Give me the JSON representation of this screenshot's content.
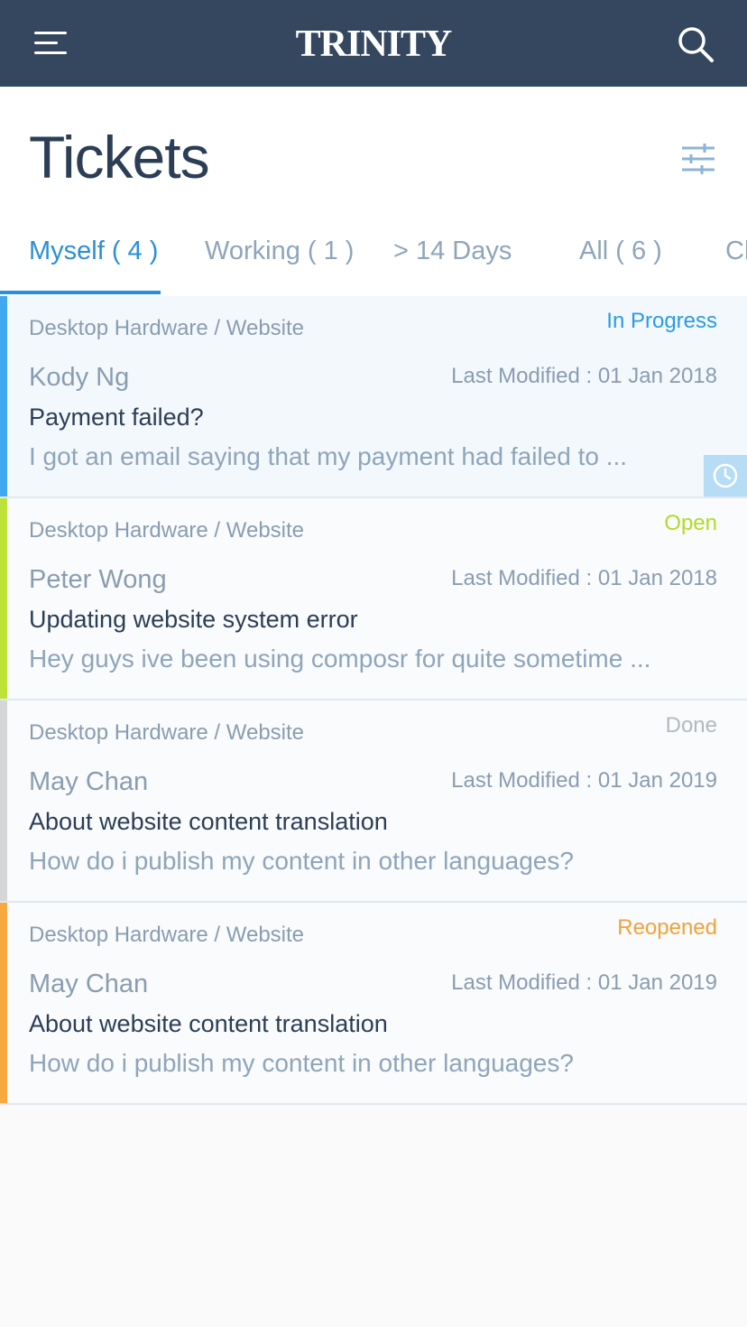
{
  "app": {
    "brand": "TRINITY",
    "icons": {
      "menu": "hamburger-menu-icon",
      "search": "search-icon"
    }
  },
  "header": {
    "title": "Tickets",
    "filter_icon": "sliders-filter-icon"
  },
  "tabs": [
    {
      "label": "Myself ( 4 )",
      "active": true
    },
    {
      "label": "Working ( 1 )",
      "active": false
    },
    {
      "label": "> 14 Days",
      "active": false
    },
    {
      "label": "All ( 6 )",
      "active": false
    },
    {
      "label": "Cl",
      "active": false
    }
  ],
  "tickets": [
    {
      "category": "Desktop Hardware / Website",
      "status": "In Progress",
      "status_color": "#2b9be4",
      "bar_color": "#41a7ee",
      "author": "Kody Ng",
      "modified": "Last Modified : 01 Jan 2018",
      "subject": "Payment failed?",
      "preview": "I got an email saying that my payment had failed to ...",
      "selected": true,
      "action_icon": "clock-icon"
    },
    {
      "category": "Desktop Hardware / Website",
      "status": "Open",
      "status_color": "#b5d925",
      "bar_color": "#bde33a",
      "author": "Peter Wong",
      "modified": "Last Modified : 01 Jan 2018",
      "subject": "Updating website system error",
      "preview": "Hey guys ive been using composr for quite sometime ...",
      "selected": false
    },
    {
      "category": "Desktop Hardware / Website",
      "status": "Done",
      "status_color": "#b3b9be",
      "bar_color": "#d6d6d6",
      "author": "May Chan",
      "modified": "Last Modified : 01 Jan 2019",
      "subject": "About website content translation",
      "preview": "How do i publish my content in other languages?",
      "selected": false
    },
    {
      "category": "Desktop Hardware / Website",
      "status": "Reopened",
      "status_color": "#f2a23a",
      "bar_color": "#f7a940",
      "author": "May Chan",
      "modified": "Last Modified : 01 Jan 2019",
      "subject": "About website content translation",
      "preview": "How do i publish my content in other languages?",
      "selected": false
    }
  ]
}
